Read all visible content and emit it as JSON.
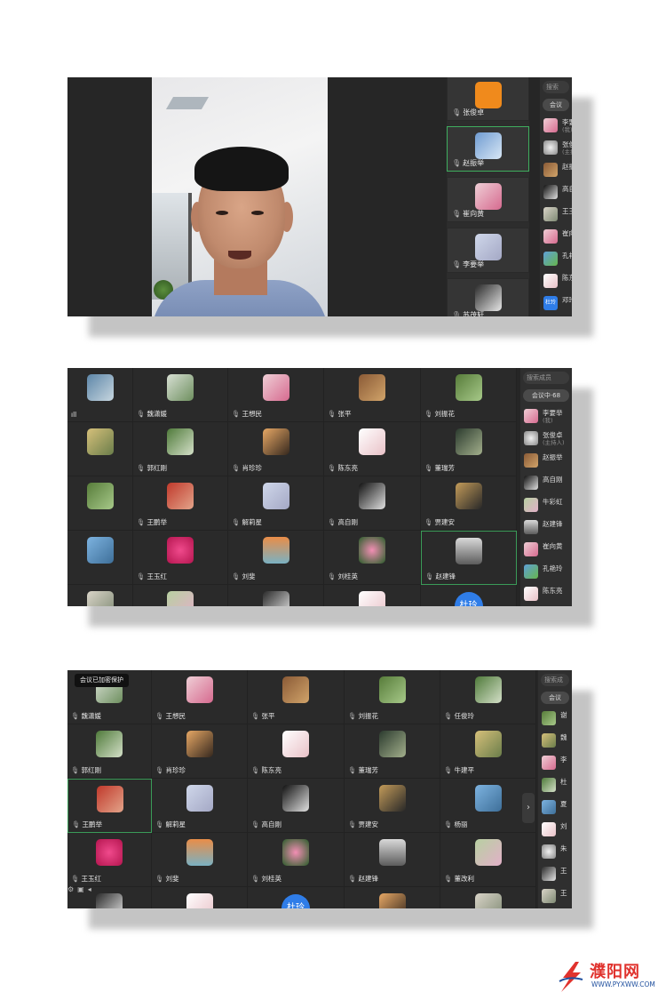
{
  "screen1": {
    "strip": [
      {
        "name": "张俊卓",
        "thumb": "orange-sq"
      },
      {
        "name": "赵振举",
        "thumb": "c23",
        "active": true
      },
      {
        "name": "崔向黄",
        "thumb": "c3"
      },
      {
        "name": "李要举",
        "thumb": "c12"
      },
      {
        "name": "苏茂轩",
        "thumb": "c24"
      }
    ],
    "sidebar": {
      "search_placeholder": "搜索",
      "pill": "会议",
      "members": [
        {
          "name": "李要",
          "sub": "(我)",
          "av": "c3"
        },
        {
          "name": "张俊",
          "sub": "(主持",
          "av": "c22"
        },
        {
          "name": "赵振",
          "sub": "",
          "av": "c4"
        },
        {
          "name": "高自",
          "sub": "",
          "av": "c13"
        },
        {
          "name": "王玉",
          "sub": "",
          "av": "c21"
        },
        {
          "name": "崔向",
          "sub": "",
          "av": "c3"
        },
        {
          "name": "孔艳",
          "sub": "",
          "av": "c25"
        },
        {
          "name": "陈东",
          "sub": "",
          "av": "c8"
        },
        {
          "name": "邓玲",
          "sub": "",
          "av": "blue",
          "badge": "杜玲"
        }
      ]
    }
  },
  "screen2": {
    "cells": [
      {
        "name": "",
        "thumb": "c1",
        "col": 0,
        "row": 0,
        "extra": "ıll"
      },
      {
        "name": "魏潇媛",
        "thumb": "c2",
        "col": 1,
        "row": 0
      },
      {
        "name": "王想民",
        "thumb": "c3",
        "col": 2,
        "row": 0
      },
      {
        "name": "张平",
        "thumb": "c4",
        "col": 3,
        "row": 0
      },
      {
        "name": "刘振花",
        "thumb": "c5",
        "col": 4,
        "row": 0
      },
      {
        "name": "",
        "thumb": "c6",
        "col": 0,
        "row": 1
      },
      {
        "name": "郭红刚",
        "thumb": "c10",
        "col": 1,
        "row": 1
      },
      {
        "name": "肖珍珍",
        "thumb": "c7",
        "col": 2,
        "row": 1
      },
      {
        "name": "陈东亮",
        "thumb": "c8",
        "col": 3,
        "row": 1
      },
      {
        "name": "董瑞芳",
        "thumb": "c9",
        "col": 4,
        "row": 1
      },
      {
        "name": "",
        "thumb": "c5",
        "col": 0,
        "row": 2
      },
      {
        "name": "王鹏举",
        "thumb": "c11",
        "col": 1,
        "row": 2
      },
      {
        "name": "解莉星",
        "thumb": "c12",
        "col": 2,
        "row": 2
      },
      {
        "name": "高自刚",
        "thumb": "c13",
        "col": 3,
        "row": 2
      },
      {
        "name": "贾建安",
        "thumb": "c14",
        "col": 4,
        "row": 2
      },
      {
        "name": "",
        "thumb": "c15",
        "col": 0,
        "row": 3
      },
      {
        "name": "王玉红",
        "thumb": "c16",
        "col": 1,
        "row": 3
      },
      {
        "name": "刘斐",
        "thumb": "c17",
        "col": 2,
        "row": 3
      },
      {
        "name": "刘桂英",
        "thumb": "c18",
        "col": 3,
        "row": 3
      },
      {
        "name": "赵建锋",
        "thumb": "c19",
        "col": 4,
        "row": 3,
        "selected": true
      },
      {
        "name": "",
        "thumb": "c21",
        "col": 0,
        "row": 4
      },
      {
        "name": "",
        "thumb": "c20",
        "col": 1,
        "row": 4
      },
      {
        "name": "",
        "thumb": "c24",
        "col": 2,
        "row": 4
      },
      {
        "name": "",
        "thumb": "c8",
        "col": 3,
        "row": 4
      },
      {
        "name": "",
        "thumb": "blue",
        "col": 4,
        "row": 4,
        "badge": "杜玲"
      }
    ],
    "sidebar": {
      "search_placeholder": "搜索成员",
      "pill": "会议中·68",
      "members": [
        {
          "name": "李要举",
          "sub": "(我)",
          "av": "c3"
        },
        {
          "name": "张俊卓",
          "sub": "(主持人)",
          "av": "c22"
        },
        {
          "name": "赵振举",
          "sub": "",
          "av": "c4"
        },
        {
          "name": "高自刚",
          "sub": "",
          "av": "c13"
        },
        {
          "name": "牛彩虹",
          "sub": "",
          "av": "c20"
        },
        {
          "name": "赵建锋",
          "sub": "",
          "av": "c19"
        },
        {
          "name": "崔向黄",
          "sub": "",
          "av": "c3"
        },
        {
          "name": "孔艳玲",
          "sub": "",
          "av": "c25"
        },
        {
          "name": "陈东亮",
          "sub": "",
          "av": "c8"
        }
      ]
    }
  },
  "screen3": {
    "tooltip": "会议已加密保护",
    "next_label": "›",
    "cells": [
      {
        "name": "魏潇媛",
        "thumb": "c2",
        "col": 0,
        "row": 0
      },
      {
        "name": "王想民",
        "thumb": "c3",
        "col": 1,
        "row": 0
      },
      {
        "name": "张平",
        "thumb": "c4",
        "col": 2,
        "row": 0
      },
      {
        "name": "刘振花",
        "thumb": "c5",
        "col": 3,
        "row": 0
      },
      {
        "name": "任俊玲",
        "thumb": "c10",
        "col": 4,
        "row": 0
      },
      {
        "name": "郭红刚",
        "thumb": "c10",
        "col": 0,
        "row": 1
      },
      {
        "name": "肖珍珍",
        "thumb": "c7",
        "col": 1,
        "row": 1
      },
      {
        "name": "陈东亮",
        "thumb": "c8",
        "col": 2,
        "row": 1
      },
      {
        "name": "董瑞芳",
        "thumb": "c9",
        "col": 3,
        "row": 1
      },
      {
        "name": "牛建平",
        "thumb": "c6",
        "col": 4,
        "row": 1
      },
      {
        "name": "王鹏举",
        "thumb": "c11",
        "col": 0,
        "row": 2,
        "selected": true
      },
      {
        "name": "解莉星",
        "thumb": "c12",
        "col": 1,
        "row": 2
      },
      {
        "name": "高自刚",
        "thumb": "c13",
        "col": 2,
        "row": 2
      },
      {
        "name": "贾建安",
        "thumb": "c14",
        "col": 3,
        "row": 2
      },
      {
        "name": "杨丽",
        "thumb": "c15",
        "col": 4,
        "row": 2
      },
      {
        "name": "王玉红",
        "thumb": "c16",
        "col": 0,
        "row": 3
      },
      {
        "name": "刘斐",
        "thumb": "c17",
        "col": 1,
        "row": 3
      },
      {
        "name": "刘桂英",
        "thumb": "c18",
        "col": 2,
        "row": 3
      },
      {
        "name": "赵建锋",
        "thumb": "c19",
        "col": 3,
        "row": 3
      },
      {
        "name": "董改利",
        "thumb": "c20",
        "col": 4,
        "row": 3
      },
      {
        "name": "",
        "thumb": "c24",
        "col": 0,
        "row": 4
      },
      {
        "name": "",
        "thumb": "c8",
        "col": 1,
        "row": 4
      },
      {
        "name": "",
        "thumb": "blue",
        "col": 2,
        "row": 4,
        "badge": "杜玲"
      },
      {
        "name": "",
        "thumb": "c7",
        "col": 3,
        "row": 4
      },
      {
        "name": "",
        "thumb": "c21",
        "col": 4,
        "row": 4
      }
    ],
    "sidebar": {
      "search_placeholder": "搜索成",
      "pill": "会议",
      "members": [
        {
          "name": "谢",
          "sub": "",
          "av": "c5"
        },
        {
          "name": "魏",
          "sub": "",
          "av": "c6"
        },
        {
          "name": "李",
          "sub": "",
          "av": "c3"
        },
        {
          "name": "杜",
          "sub": "",
          "av": "c10"
        },
        {
          "name": "夏",
          "sub": "",
          "av": "c15"
        },
        {
          "name": "刘",
          "sub": "",
          "av": "c8"
        },
        {
          "name": "朱",
          "sub": "",
          "av": "c22"
        },
        {
          "name": "王",
          "sub": "",
          "av": "c24"
        },
        {
          "name": "王",
          "sub": "",
          "av": "c21"
        }
      ]
    }
  },
  "watermark": {
    "brand": "濮阳网",
    "url": "WWW.PYXWW.COM"
  }
}
